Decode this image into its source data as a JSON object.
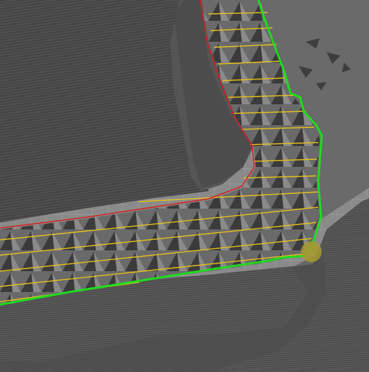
{
  "viewport": {
    "type": "slicer-layer-preview",
    "colors": {
      "build_plate": "#8a8a8a",
      "build_plate_grid": "#9c9c9c",
      "model_shadow": "#5a5a5a",
      "model_surface": "#4d4d4d",
      "model_ridges": "#3a3a3a",
      "outer_wall": "#1fdc1f",
      "inner_wall": "#d61e1e",
      "infill": "#e8c21a",
      "seam_marker": "#a79a2c"
    },
    "line_types": [
      "outer-wall",
      "inner-wall",
      "infill"
    ],
    "icons": [
      "seam-marker-icon"
    ]
  }
}
